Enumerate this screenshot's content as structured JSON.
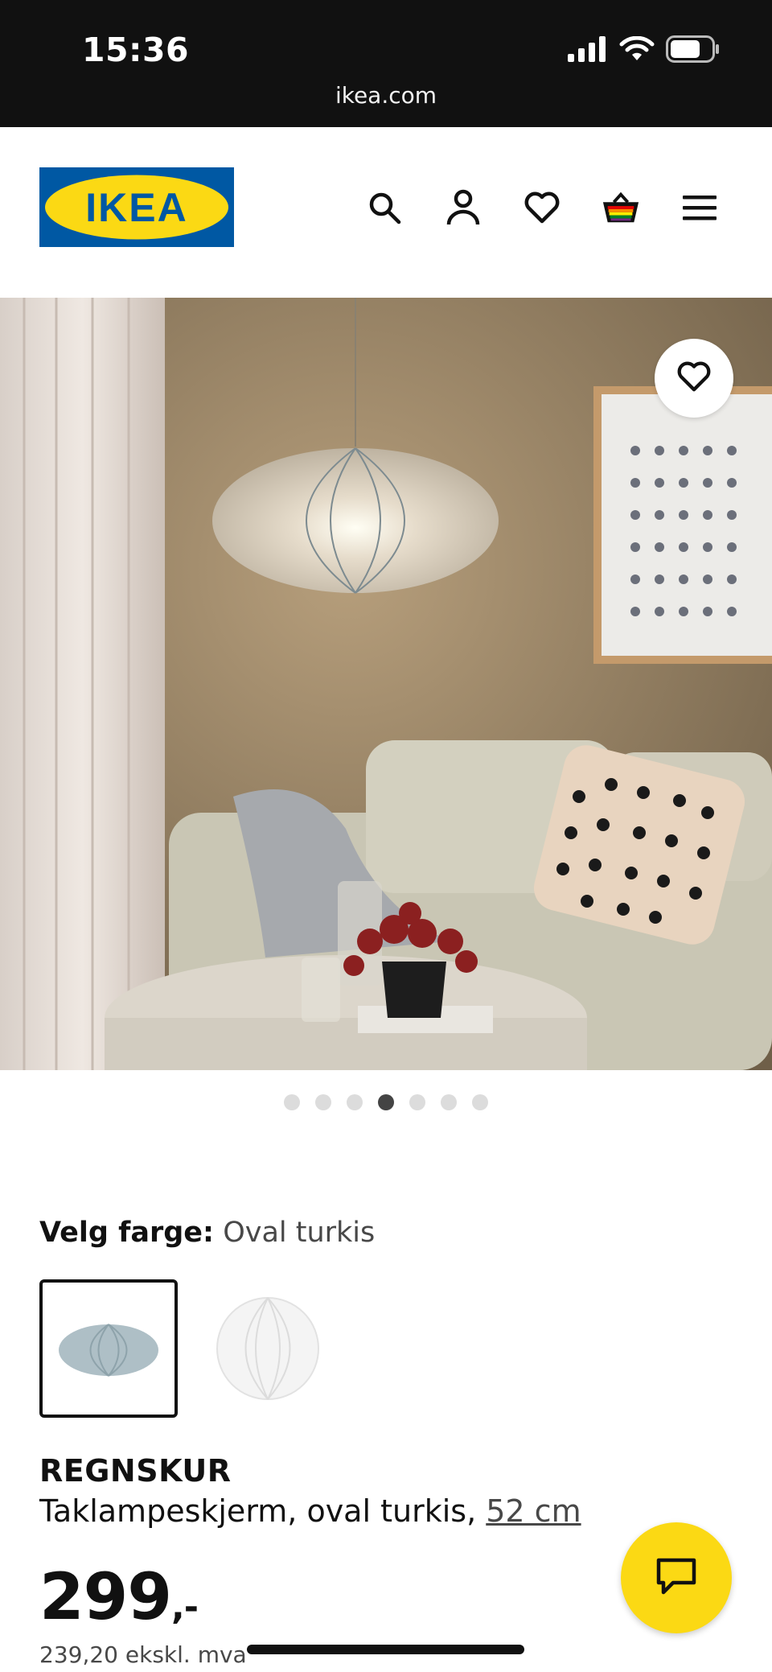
{
  "status_bar": {
    "time": "15:36",
    "url": "ikea.com",
    "icons": [
      "signal-icon",
      "wifi-icon",
      "battery-icon"
    ]
  },
  "header": {
    "logo_text": "IKEA",
    "icons": [
      "search-icon",
      "account-icon",
      "favourites-icon",
      "basket-icon",
      "menu-icon"
    ]
  },
  "gallery": {
    "image_count": 7,
    "active_index": 3,
    "favourite_icon": "heart-icon"
  },
  "color_selection": {
    "label": "Velg farge:",
    "value": "Oval turkis",
    "swatches": [
      {
        "name": "oval turkis",
        "selected": true
      },
      {
        "name": "white round",
        "selected": false
      }
    ]
  },
  "product": {
    "name": "REGNSKUR",
    "description": "Taklampeskjerm, oval turkis,",
    "size_link": "52 cm",
    "price": "299",
    "price_suffix": ",-",
    "price_ex_vat": "239,20 ekskl. mva"
  },
  "chat": {
    "icon": "chat-icon"
  },
  "colors": {
    "ikea_blue": "#0058a3",
    "ikea_yellow": "#fbd914",
    "status_bar_bg": "#111111"
  }
}
